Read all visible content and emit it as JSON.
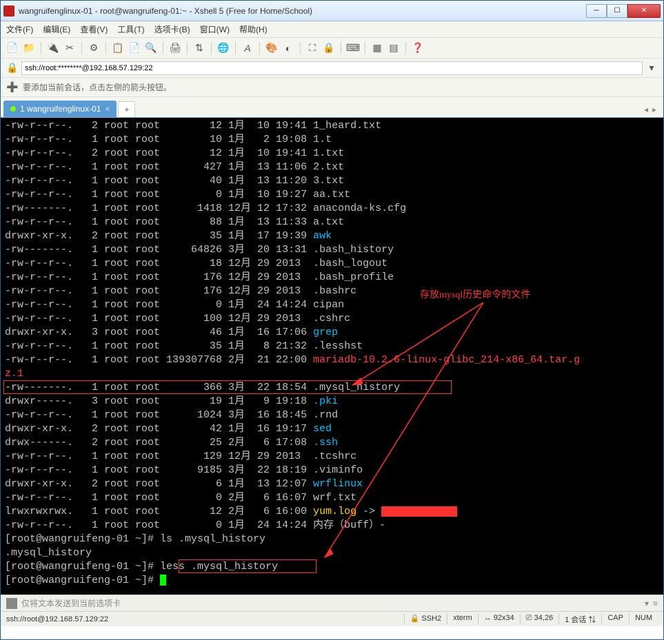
{
  "titlebar": {
    "text": "wangruifenglinux-01 - root@wangruifeng-01:~ - Xshell 5 (Free for Home/School)"
  },
  "menu": {
    "items": [
      "文件(F)",
      "编辑(E)",
      "查看(V)",
      "工具(T)",
      "选项卡(B)",
      "窗口(W)",
      "帮助(H)"
    ]
  },
  "addr": {
    "value": "ssh://root:********@192.168.57.129:22"
  },
  "hint": {
    "text": "要添加当前会话，点击左侧的箭头按钮。"
  },
  "tab": {
    "label": "1 wangruifenglinux-01",
    "add": "+"
  },
  "annot": {
    "label": "存放mysql历史命令的文件"
  },
  "term": {
    "rows": [
      {
        "p": "-rw-r--r--.   2 root root        12 1月  10 19:41 ",
        "n": "1_heard.txt",
        "c": ""
      },
      {
        "p": "-rw-r--r--.   1 root root        10 1月   2 19:08 ",
        "n": "1.t",
        "c": ""
      },
      {
        "p": "-rw-r--r--.   2 root root        12 1月  10 19:41 ",
        "n": "1.txt",
        "c": ""
      },
      {
        "p": "-rw-r--r--.   1 root root       427 1月  13 11:06 ",
        "n": "2.txt",
        "c": ""
      },
      {
        "p": "-rw-r--r--.   1 root root        40 1月  13 11:20 ",
        "n": "3.txt",
        "c": ""
      },
      {
        "p": "-rw-r--r--.   1 root root         0 1月  10 19:27 ",
        "n": "aa.txt",
        "c": ""
      },
      {
        "p": "-rw-------.   1 root root      1418 12月 12 17:32 ",
        "n": "anaconda-ks.cfg",
        "c": ""
      },
      {
        "p": "-rw-r--r--.   1 root root        88 1月  13 11:33 ",
        "n": "a.txt",
        "c": ""
      },
      {
        "p": "drwxr-xr-x.   2 root root        35 1月  17 19:39 ",
        "n": "awk",
        "c": "cyan"
      },
      {
        "p": "-rw-------.   1 root root     64826 3月  20 13:31 ",
        "n": ".bash_history",
        "c": ""
      },
      {
        "p": "-rw-r--r--.   1 root root        18 12月 29 2013  ",
        "n": ".bash_logout",
        "c": ""
      },
      {
        "p": "-rw-r--r--.   1 root root       176 12月 29 2013  ",
        "n": ".bash_profile",
        "c": ""
      },
      {
        "p": "-rw-r--r--.   1 root root       176 12月 29 2013  ",
        "n": ".bashrc",
        "c": ""
      },
      {
        "p": "-rw-r--r--.   1 root root         0 1月  24 14:24 ",
        "n": "cipan",
        "c": ""
      },
      {
        "p": "-rw-r--r--.   1 root root       100 12月 29 2013  ",
        "n": ".cshrc",
        "c": ""
      },
      {
        "p": "drwxr-xr-x.   3 root root        46 1月  16 17:06 ",
        "n": "grep",
        "c": "cyan"
      },
      {
        "p": "-rw-r--r--.   1 root root        35 1月   8 21:32 ",
        "n": ".lesshst",
        "c": ""
      },
      {
        "p": "-rw-r--r--.   1 root root 139307768 2月  21 22:00 ",
        "n": "mariadb-10.2.6-linux-glibc_214-x86_64.tar.g",
        "c": "red"
      },
      {
        "p": "",
        "n": "z.1",
        "c": "red"
      },
      {
        "p": "-rw-------.   1 root root       366 3月  22 18:54 ",
        "n": ".mysql_history",
        "c": ""
      },
      {
        "p": "drwxr-----.   3 root root        19 1月   9 19:18 ",
        "n": ".pki",
        "c": "cyan"
      },
      {
        "p": "-rw-r--r--.   1 root root      1024 3月  16 18:45 ",
        "n": ".rnd",
        "c": ""
      },
      {
        "p": "drwxr-xr-x.   2 root root        42 1月  16 19:17 ",
        "n": "sed",
        "c": "cyan"
      },
      {
        "p": "drwx------.   2 root root        25 2月   6 17:08 ",
        "n": ".ssh",
        "c": "cyan"
      },
      {
        "p": "-rw-r--r--.   1 root root       129 12月 29 2013  ",
        "n": ".tcshrc",
        "c": ""
      },
      {
        "p": "-rw-r--r--.   1 root root      9185 3月  22 18:19 ",
        "n": ".viminfo",
        "c": ""
      },
      {
        "p": "drwxr-xr-x.   2 root root         6 1月  13 12:07 ",
        "n": "wrflinux",
        "c": "cyan"
      },
      {
        "p": "-rw-r--r--.   1 root root         0 2月   6 16:07 ",
        "n": "wrf.txt",
        "c": ""
      },
      {
        "p": "lrwxrwxrwx.   1 root root        12 2月   6 16:00 ",
        "n": "yum.log",
        "c": "yellow",
        "suf": " -> "
      },
      {
        "p": "-rw-r--r--.   1 root root         0 1月  24 14:24 ",
        "n": "内存（buff）-",
        "c": ""
      }
    ],
    "p1a": "[root@wangruifeng-01 ~]# ",
    "p1b": "ls .mysql_history",
    "out1": ".mysql_history",
    "p2a": "[root@wangruifeng-01 ~]# ",
    "p2b": "less .mysql_history",
    "p3": "[root@wangruifeng-01 ~]# "
  },
  "sendbar": {
    "text": "仅将文本发送到当前选项卡"
  },
  "status": {
    "left": "ssh://root@192.168.57.129:22",
    "ssh": "SSH2",
    "term": "xterm",
    "size": "92x34",
    "pos": "34,26",
    "sess": "1 会话",
    "caps": "CAP",
    "num": "NUM"
  }
}
